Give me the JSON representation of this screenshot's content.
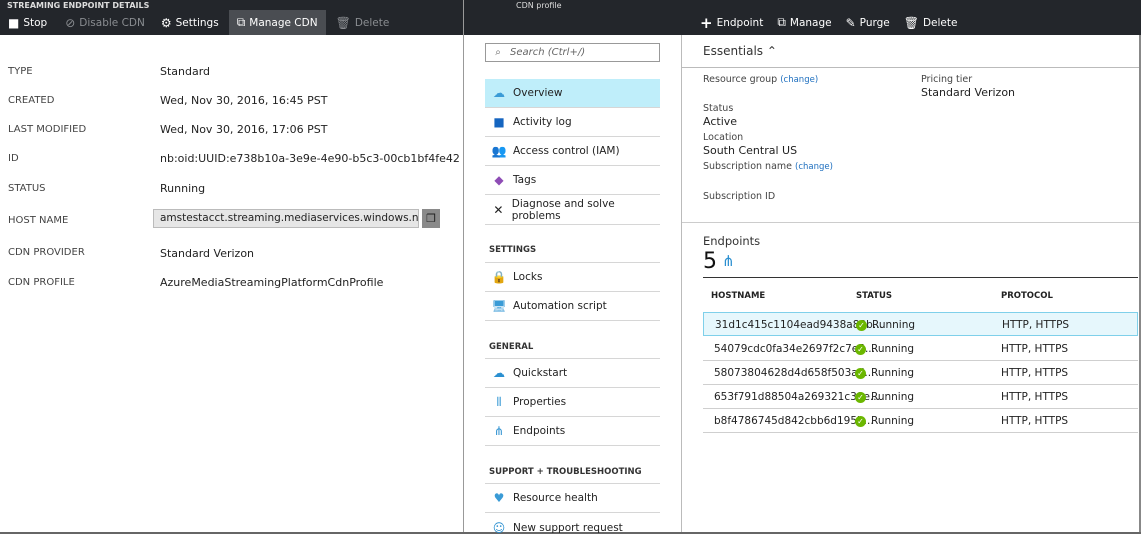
{
  "left": {
    "title": "STREAMING ENDPOINT DETAILS",
    "toolbar": [
      {
        "label": "Stop",
        "icon": "stop-icon"
      },
      {
        "label": "Disable CDN",
        "icon": "disable-icon"
      },
      {
        "label": "Settings",
        "icon": "gear-icon"
      },
      {
        "label": "Manage CDN",
        "icon": "external-link-icon"
      },
      {
        "label": "Delete",
        "icon": "trash-icon"
      }
    ],
    "fields": [
      {
        "label": "TYPE",
        "value": "Standard"
      },
      {
        "label": "CREATED",
        "value": "Wed, Nov 30, 2016, 16:45 PST"
      },
      {
        "label": "LAST MODIFIED",
        "value": "Wed, Nov 30, 2016, 17:06 PST"
      },
      {
        "label": "ID",
        "value": "nb:oid:UUID:e738b10a-3e9e-4e90-b5c3-00cb1bf4fe42"
      },
      {
        "label": "STATUS",
        "value": "Running"
      },
      {
        "label": "HOST NAME",
        "value": "amstestacct.streaming.mediaservices.windows.net"
      },
      {
        "label": "CDN PROVIDER",
        "value": "Standard Verizon"
      },
      {
        "label": "CDN PROFILE",
        "value": "AzureMediaStreamingPlatformCdnProfile"
      }
    ]
  },
  "right": {
    "title": "CDN profile",
    "toolbar": [
      {
        "label": "Endpoint",
        "icon": "plus-icon"
      },
      {
        "label": "Manage",
        "icon": "external-link-icon"
      },
      {
        "label": "Purge",
        "icon": "purge-icon"
      },
      {
        "label": "Delete",
        "icon": "trash-icon"
      }
    ],
    "search_placeholder": "Search (Ctrl+/)",
    "menu": {
      "items1": [
        "Overview",
        "Activity log",
        "Access control (IAM)",
        "Tags",
        "Diagnose and solve problems"
      ],
      "settings_header": "SETTINGS",
      "settings": [
        "Locks",
        "Automation script"
      ],
      "general_header": "GENERAL",
      "general": [
        "Quickstart",
        "Properties",
        "Endpoints"
      ],
      "support_header": "SUPPORT + TROUBLESHOOTING",
      "support": [
        "Resource health",
        "New support request"
      ]
    },
    "essentials": {
      "title": "Essentials",
      "resource_group_label": "Resource group",
      "change": "(change)",
      "pricing_tier_label": "Pricing tier",
      "pricing_tier": "Standard Verizon",
      "status_label": "Status",
      "status": "Active",
      "location_label": "Location",
      "location": "South Central US",
      "subscription_name_label": "Subscription name",
      "subscription_id_label": "Subscription ID"
    },
    "endpoints": {
      "title": "Endpoints",
      "count": "5",
      "columns": [
        "HOSTNAME",
        "STATUS",
        "PROTOCOL"
      ],
      "rows": [
        [
          "31d1c415c1104ead9438a88b...",
          "Running",
          "HTTP, HTTPS"
        ],
        [
          "54079cdc0fa34e2697f2c7e5...",
          "Running",
          "HTTP, HTTPS"
        ],
        [
          "58073804628d4d658f503ad...",
          "Running",
          "HTTP, HTTPS"
        ],
        [
          "653f791d88504a269321c38e...",
          "Running",
          "HTTP, HTTPS"
        ],
        [
          "b8f4786745d842cbb6d195b...",
          "Running",
          "HTTP, HTTPS"
        ]
      ]
    }
  },
  "colors": {
    "header": "#23262b",
    "selected": "#bfeefa",
    "running": "#6bb700",
    "link": "#1e6fbf"
  }
}
